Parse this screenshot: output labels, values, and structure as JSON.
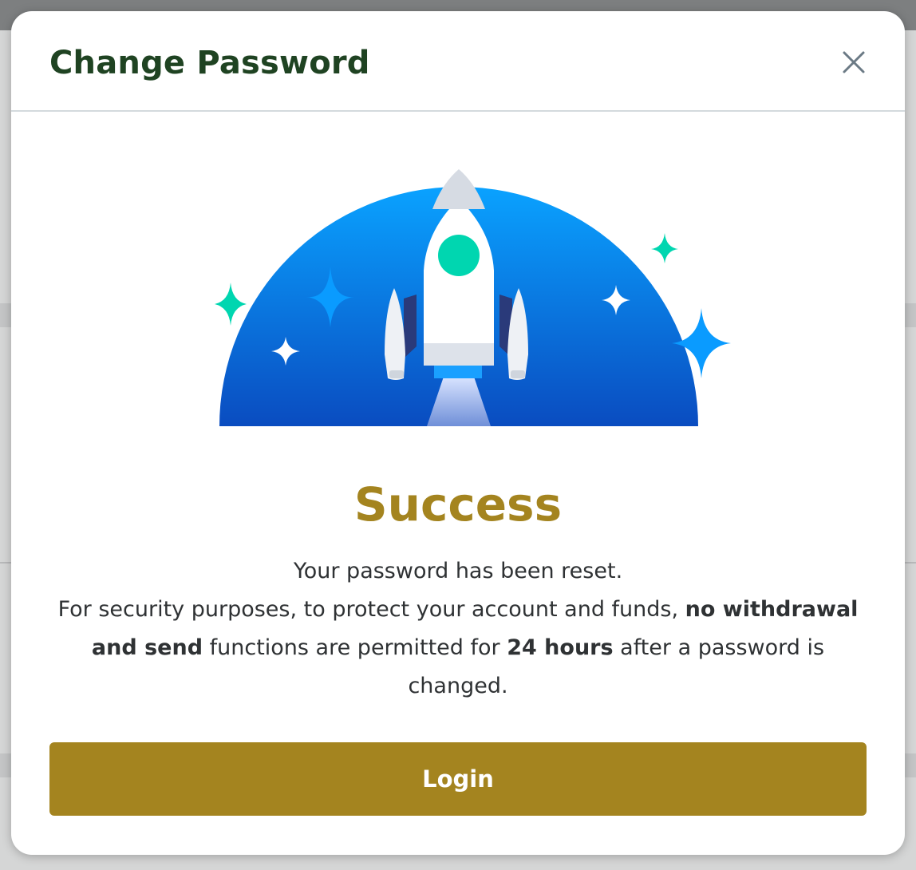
{
  "modal": {
    "title": "Change Password",
    "close_icon": "close-icon",
    "illustration_icon": "rocket-launch-illustration"
  },
  "success": {
    "title": "Success",
    "line1": "Your password has been reset.",
    "line2_pre": "For security purposes, to protect your account and funds, ",
    "line2_bold1": "no withdrawal and send",
    "line2_mid": " functions are permitted for ",
    "line2_bold2": "24 hours",
    "line2_post": " after a password is changed."
  },
  "actions": {
    "login_label": "Login"
  },
  "colors": {
    "accent": "#a4841f",
    "title": "#1f4322",
    "overlay": "#7d7f80",
    "dome_top": "#0a9bff",
    "dome_bottom": "#0a4fc4",
    "sparkle_teal": "#00d6b0"
  }
}
